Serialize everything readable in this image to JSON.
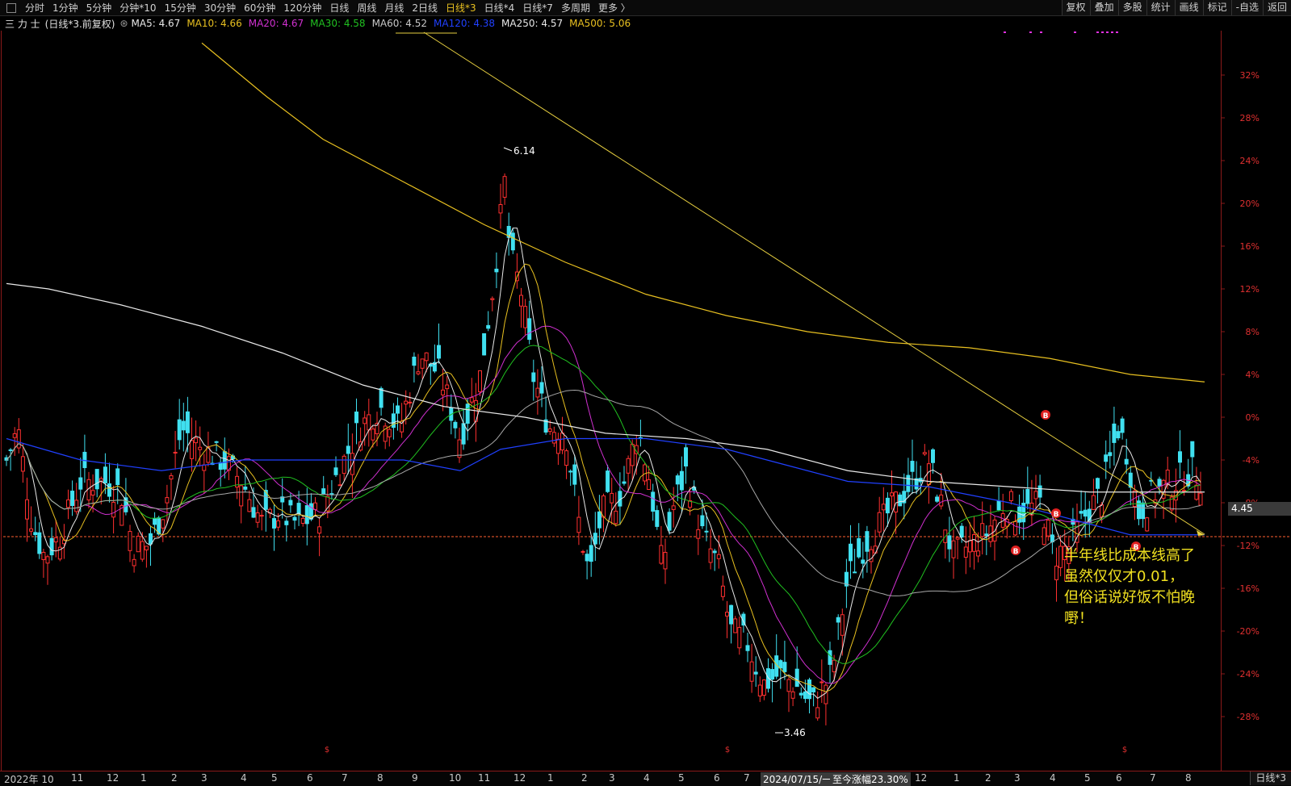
{
  "topbar": {
    "periods": [
      "分时",
      "1分钟",
      "5分钟",
      "分钟*10",
      "15分钟",
      "30分钟",
      "60分钟",
      "120分钟",
      "日线",
      "周线",
      "月线",
      "2日线",
      "日线*3",
      "日线*4",
      "日线*7",
      "多周期",
      "更多 〉"
    ],
    "active_period": "日线*3",
    "tools": [
      "复权",
      "叠加",
      "多股",
      "统计",
      "画线",
      "标记",
      "-自选",
      "返回"
    ]
  },
  "stock": {
    "name": "三 力 士",
    "mode": "(日线*3.前复权)"
  },
  "ma_legend": [
    {
      "label": "MA5: 4.67",
      "color": "#e8e8e8"
    },
    {
      "label": "MA10: 4.66",
      "color": "#e8c020"
    },
    {
      "label": "MA20: 4.67",
      "color": "#d030d0"
    },
    {
      "label": "MA30: 4.58",
      "color": "#20c020"
    },
    {
      "label": "MA60: 4.52",
      "color": "#c8c8c8"
    },
    {
      "label": "MA120: 4.38",
      "color": "#2040ff"
    },
    {
      "label": "MA250: 4.57",
      "color": "#e8e8e8"
    },
    {
      "label": "MA500: 5.06",
      "color": "#e8c020"
    }
  ],
  "annotation": {
    "lines": [
      "半年线比成本线高了",
      "虽然仅仅才0.01，",
      "但俗话说好饭不怕晚",
      "嘢！"
    ]
  },
  "bottom": {
    "tab": "日线*3",
    "cursor_date": "2024/07/15/一",
    "cursor_change": "至今涨幅23.30%"
  },
  "colors": {
    "up": "#ff3030",
    "down": "#40e0f0",
    "ma500": "#e8c020",
    "ma250": "#e8e8e8",
    "ma120": "#2040ff",
    "ma60": "#c8c8c8",
    "ma30": "#20c020",
    "ma20": "#d030d0",
    "ma10": "#e8c020",
    "ma5": "#e8e8e8",
    "trend": "#e8d040",
    "cost_line": "#ff6030"
  },
  "chart_data": {
    "type": "candlestick",
    "y_axis": {
      "unit": "%",
      "ticks": [
        "32%",
        "28%",
        "24%",
        "20%",
        "16%",
        "12%",
        "8%",
        "4%",
        "0%",
        "-4%",
        "-8%",
        "-12%",
        "-16%",
        "-20%",
        "-24%",
        "-28%"
      ]
    },
    "x_axis": {
      "labels": [
        "2022年 10",
        "11",
        "12",
        "1",
        "2",
        "3",
        "4",
        "5",
        "6",
        "7",
        "8",
        "9",
        "10",
        "11",
        "12",
        "1",
        "2",
        "3",
        "4",
        "5",
        "6",
        "7",
        "2024/07/15/一",
        "12",
        "1",
        "2",
        "3",
        "4",
        "5",
        "6",
        "7",
        "8"
      ]
    },
    "current_price": "4.45",
    "annotations": {
      "high": "6.14",
      "low": "3.46"
    },
    "markers": [
      "B",
      "B",
      "B",
      "B"
    ],
    "price_at_zero_pct": 5.0
  }
}
